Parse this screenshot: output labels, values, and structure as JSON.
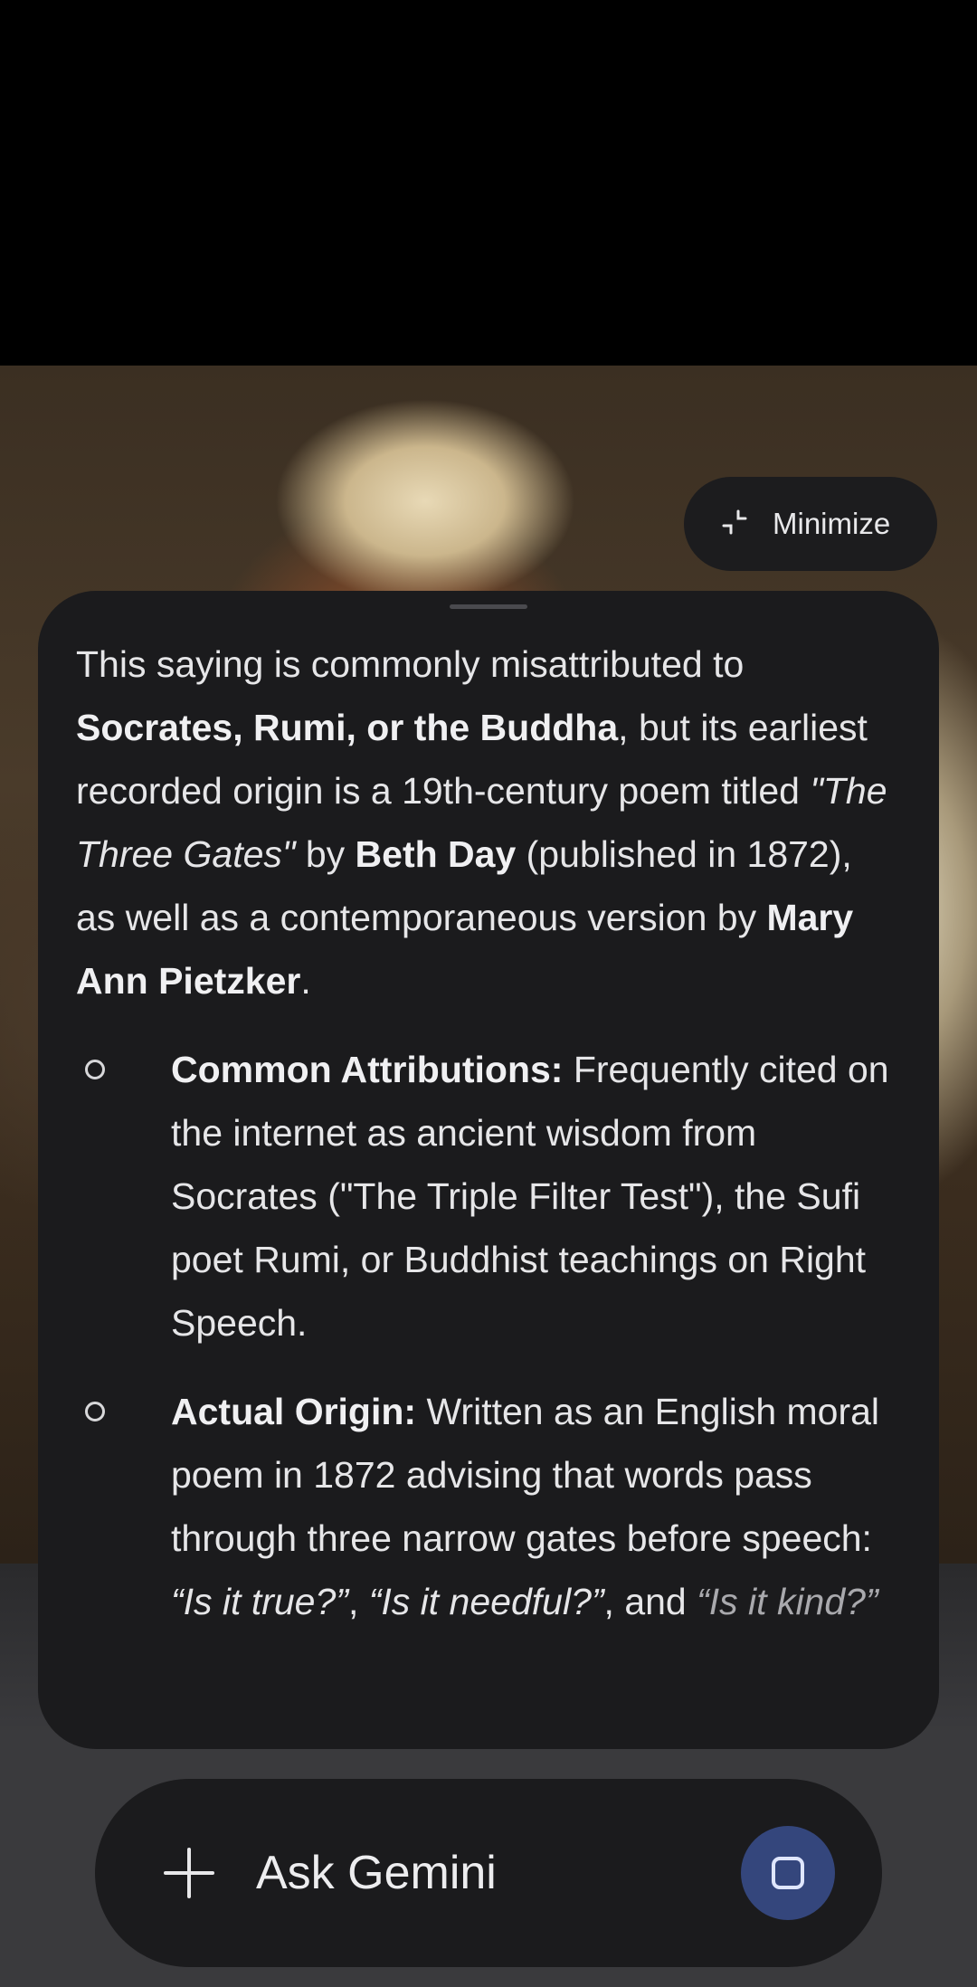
{
  "background": {
    "description_icon": "painting-image"
  },
  "minimize": {
    "label": "Minimize",
    "icon": "minimize-icon"
  },
  "response": {
    "intro": {
      "t1": "This saying is commonly misattributed to ",
      "b1": "Socrates, Rumi, or the Buddha",
      "t2": ", but its earliest recorded origin is a 19th-century poem titled ",
      "i1": "\"The Three Gates\"",
      "t3": " by ",
      "b2": "Beth Day",
      "t4": " (published in 1872), as well as a contemporaneous version by ",
      "b3": "Mary Ann Pietzker",
      "t5": "."
    },
    "bullets": [
      {
        "heading": "Common Attributions:",
        "text": " Frequently cited on the internet as ancient wisdom from Socrates (\"The Triple Filter Test\"), the Sufi poet Rumi, or Buddhist teachings on Right Speech."
      },
      {
        "heading": "Actual Origin:",
        "text": " Written as an English moral poem in 1872 advising that words pass through three narrow gates before speech: ",
        "q1": "“Is it true?”",
        "sep1": ", ",
        "q2": "“Is it needful?”",
        "sep2": ", and ",
        "q3": "“Is it kind?”"
      }
    ]
  },
  "ask_bar": {
    "placeholder": "Ask Gemini",
    "plus_icon": "plus-icon",
    "stop_icon": "stop-icon"
  },
  "colors": {
    "card_bg": "#1b1b1d",
    "stop_button_bg": "#34467c",
    "text": "#e6e6e8"
  }
}
